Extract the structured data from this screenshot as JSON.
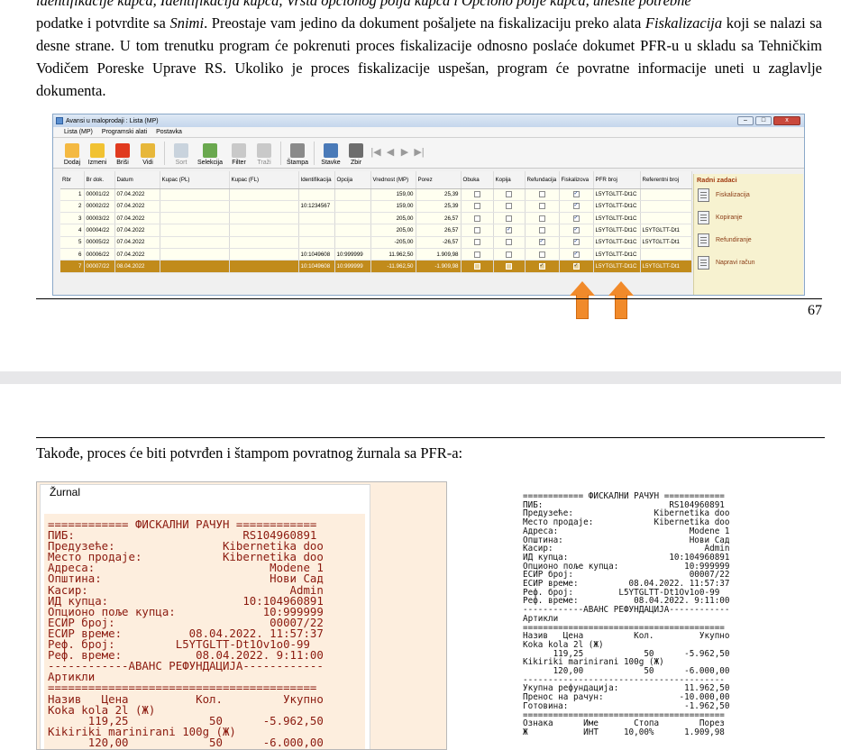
{
  "top_page": {
    "paragraph_line1": "identifikacije kupca, Identifikacija kupca, Vrsta opcionog polja kupca i Opciono polje kupca, unesite potrebne",
    "paragraph_pre_snimi": "podatke i potvrdite sa ",
    "snimi": "Snimi",
    "paragraph_post_snimi": ". Preostaje vam jedino da dokument pošaljete na fiskalizaciju preko alata",
    "fiskalizacija": "Fiskalizacija",
    "paragraph_post_fiskal": " koji se nalazi sa desne strane. U tom trenutku program će pokrenuti proces fiskalizacije odnosno poslaće dokumet PFR-u u skladu sa Tehničkim Vodičem Poreske Uprave RS. Ukoliko je proces fiskalizacije uspešan, program će povratne informacije uneti u zaglavlje dokumenta.",
    "page_number": "67"
  },
  "window": {
    "title": "Avansi u maloprodaji : Lista (MP)",
    "controls": [
      "–",
      "□",
      "x"
    ],
    "menu": [
      "Lista (MP)",
      "Programski alati",
      "Postavka"
    ],
    "toolbar": [
      {
        "label": "Dodaj",
        "icon": "add-doc-icon",
        "color": "#f4b942",
        "dim": false
      },
      {
        "label": "Izmeni",
        "icon": "folder-edit-icon",
        "color": "#f1c232",
        "dim": false
      },
      {
        "label": "Briši",
        "icon": "delete-x-icon",
        "color": "#e03a1e",
        "dim": false
      },
      {
        "label": "Vidi",
        "icon": "view-folder-icon",
        "color": "#e7b73a",
        "dim": false
      },
      {
        "label": "Sort",
        "icon": "sort-icon",
        "color": "#c9d3dd",
        "dim": true
      },
      {
        "label": "Selekcija",
        "icon": "selection-icon",
        "color": "#6aa84f",
        "dim": false
      },
      {
        "label": "Filter",
        "icon": "filter-icon",
        "color": "#c9c9c9",
        "dim": false
      },
      {
        "label": "Traži",
        "icon": "search-icon",
        "color": "#c9c9c9",
        "dim": true
      },
      {
        "label": "Štampa",
        "icon": "print-icon",
        "color": "#8a8a8a",
        "dim": false
      },
      {
        "label": "Stavke",
        "icon": "items-tree-icon",
        "color": "#4a7ab8",
        "dim": false
      },
      {
        "label": "Zbir",
        "icon": "sum-icon",
        "color": "#6d6d6d",
        "dim": false
      }
    ],
    "nav_arrows": [
      "|◀",
      "◀",
      "▶",
      "▶|"
    ],
    "columns": [
      "Rbr",
      "Br dok.",
      "Datum",
      "Kupac (PL)",
      "Kupac (FL)",
      "Identifikacija",
      "Opcija",
      "Vrednost (MP)",
      "Porez",
      "Obuka",
      "Kopija",
      "Refundacija",
      "Fiskalizova",
      "PFR broj",
      "Referentni broj"
    ],
    "rows": [
      {
        "rbr": "1",
        "br": "00001/22",
        "datum": "07.04.2022",
        "kupac_pl": "",
        "kupac_fl": "",
        "ident": "",
        "opcija": "",
        "vrednost": "159,00",
        "porez": "25,39",
        "obuka": false,
        "kopija": false,
        "refund": false,
        "fiskal": true,
        "pfr": "L5YTGLTT-Dt1C",
        "ref": "",
        "selected": false
      },
      {
        "rbr": "2",
        "br": "00002/22",
        "datum": "07.04.2022",
        "kupac_pl": "",
        "kupac_fl": "",
        "ident": "10:1234567",
        "opcija": "",
        "vrednost": "159,00",
        "porez": "25,39",
        "obuka": false,
        "kopija": false,
        "refund": false,
        "fiskal": true,
        "pfr": "L5YTGLTT-Dt1C",
        "ref": "",
        "selected": false
      },
      {
        "rbr": "3",
        "br": "00003/22",
        "datum": "07.04.2022",
        "kupac_pl": "",
        "kupac_fl": "",
        "ident": "",
        "opcija": "",
        "vrednost": "205,00",
        "porez": "26,57",
        "obuka": false,
        "kopija": false,
        "refund": false,
        "fiskal": true,
        "pfr": "L5YTGLTT-Dt1C",
        "ref": "",
        "selected": false
      },
      {
        "rbr": "4",
        "br": "00004/22",
        "datum": "07.04.2022",
        "kupac_pl": "",
        "kupac_fl": "",
        "ident": "",
        "opcija": "",
        "vrednost": "205,00",
        "porez": "26,57",
        "obuka": false,
        "kopija": true,
        "refund": false,
        "fiskal": true,
        "pfr": "L5YTGLTT-Dt1C",
        "ref": "L5YTGLTT-Dt1",
        "selected": false
      },
      {
        "rbr": "5",
        "br": "00005/22",
        "datum": "07.04.2022",
        "kupac_pl": "",
        "kupac_fl": "",
        "ident": "",
        "opcija": "",
        "vrednost": "-205,00",
        "porez": "-26,57",
        "obuka": false,
        "kopija": false,
        "refund": true,
        "fiskal": true,
        "pfr": "L5YTGLTT-Dt1C",
        "ref": "L5YTGLTT-Dt1",
        "selected": false
      },
      {
        "rbr": "6",
        "br": "00006/22",
        "datum": "07.04.2022",
        "kupac_pl": "",
        "kupac_fl": "",
        "ident": "10:1049608",
        "opcija": "10:999999",
        "vrednost": "11.962,50",
        "porez": "1.909,98",
        "obuka": false,
        "kopija": false,
        "refund": false,
        "fiskal": true,
        "pfr": "L5YTGLTT-Dt1C",
        "ref": "",
        "selected": false
      },
      {
        "rbr": "7",
        "br": "00007/22",
        "datum": "08.04.2022",
        "kupac_pl": "",
        "kupac_fl": "",
        "ident": "10:1049608",
        "opcija": "10:999999",
        "vrednost": "-11.962,50",
        "porez": "-1.909,98",
        "obuka": false,
        "kopija": false,
        "refund": true,
        "fiskal": true,
        "pfr": "L5YTGLTT-Dt1C",
        "ref": "L5YTGLTT-Dt1",
        "selected": true
      }
    ],
    "tasks_title": "Radni zadaci",
    "tasks": [
      "Fiskalizacija",
      "Kopiranje",
      "Refundiranje",
      "Napravi račun"
    ],
    "arrow_color": "#f18a2a"
  },
  "bottom_page": {
    "paragraph": "Takođe, proces će biti potvrđen i štampom povratnog žurnala sa PFR-a:",
    "journal_title": "Žurnal",
    "journal_lines": [
      "============ ФИСКАЛНИ РАЧУН ============",
      "ПИБ:                         RS104960891",
      "Предузеће:                Kibernetika doo",
      "Место продаје:            Kibernetika doo",
      "Адреса:                          Modene 1",
      "Општина:                         Нови Сад",
      "Касир:                              Admin",
      "ИД купца:                    10:104960891",
      "Опционо поље купца:             10:999999",
      "ЕСИР број:                       00007/22",
      "ЕСИР време:          08.04.2022. 11:57:37",
      "Реф. број:         L5YTGLTT-Dt1Ov1o0-99",
      "Реф. време:           08.04.2022. 9:11:00",
      "------------АВАНС РЕФУНДАЦИЈА------------",
      "Артикли",
      "========================================",
      "Назив   Цена          Кол.         Укупно",
      "Koka kola 2l (Ж)",
      "      119,25            50      -5.962,50",
      "Kikiriki marinirani 100g (Ж)",
      "      120,00            50      -6.000,00"
    ],
    "receipt_lines": [
      "============ ФИСКАЛНИ РАЧУН ============",
      "ПИБ:                         RS104960891",
      "Предузеће:                Kibernetika doo",
      "Место продаје:            Kibernetika doo",
      "Адреса:                          Modene 1",
      "Општина:                         Нови Сад",
      "Касир:                              Admin",
      "ИД купца:                    10:104960891",
      "Опционо поље купца:             10:999999",
      "ЕСИР број:                       00007/22",
      "ЕСИР време:          08.04.2022. 11:57:37",
      "Реф. број:         L5YTGLTT-Dt1Ov1o0-99",
      "Реф. време:           08.04.2022. 9:11:00",
      "------------АВАНС РЕФУНДАЦИЈА------------",
      "Артикли",
      "========================================",
      "Назив   Цена          Кол.         Укупно",
      "Koka kola 2l (Ж)",
      "      119,25            50      -5.962,50",
      "Kikiriki marinirani 100g (Ж)",
      "      120,00            50      -6.000,00",
      "----------------------------------------",
      "Укупна рефундација:             11.962,50",
      "Пренос на рачун:               -10.000,00",
      "Готовина:                       -1.962,50",
      "========================================",
      "Ознака      Име       Стопа        Порез",
      "Ж           ИНТ     10,00%      1.909,98"
    ]
  }
}
